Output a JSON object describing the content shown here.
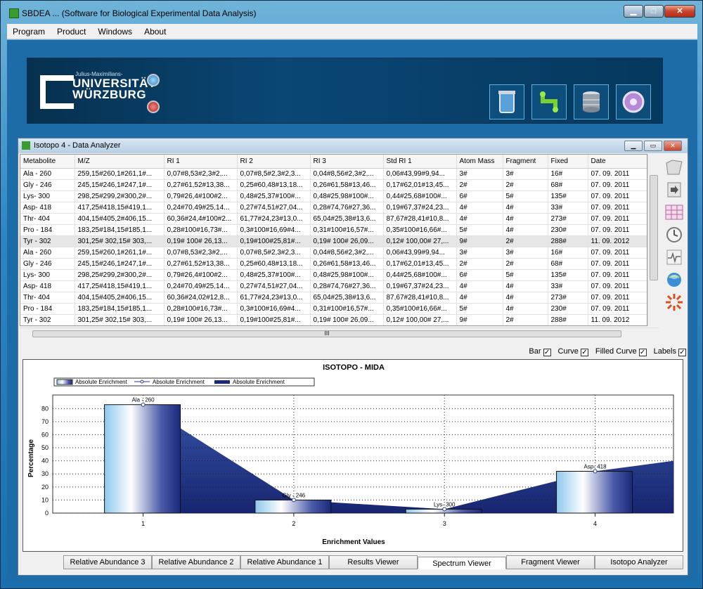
{
  "window": {
    "title": "SBDEA ... (Software for Biological Experimental Data Analysis)"
  },
  "menu": [
    "Program",
    "Product",
    "Windows",
    "About"
  ],
  "banner": {
    "logo_small": "Julius-Maximilians-",
    "logo_line1": "UNIVERSITÄT",
    "logo_line2": "WÜRZBURG"
  },
  "dialog": {
    "title": "Isotopo 4 - Data Analyzer"
  },
  "grid": {
    "columns": [
      "Metabolite",
      "M/Z",
      "RI 1",
      "RI 2",
      "RI 3",
      "Std RI 1",
      "Atom Mass",
      "Fragment",
      "Fixed",
      "Date"
    ],
    "rows": [
      [
        "Ala - 260",
        "259,15#260,1#261,1#...",
        "0,07#8,53#2,3#2,...",
        "0,07#8,5#2,3#2,3...",
        "0,04#8,56#2,3#2,...",
        "0,06#43,99#9,94...",
        "3#",
        "3#",
        "16#",
        "07. 09. 2011"
      ],
      [
        "Gly - 246",
        "245,15#246,1#247,1#...",
        "0,27#61,52#13,38...",
        "0,25#60,48#13,18...",
        "0,26#61,58#13,46...",
        "0,17#62,01#13,45...",
        "2#",
        "2#",
        "68#",
        "07. 09. 2011"
      ],
      [
        "Lys- 300",
        "298,25#299,2#300,2#...",
        "0,79#26,4#100#2...",
        "0,48#25,37#100#...",
        "0,48#25,98#100#...",
        "0,44#25,68#100#...",
        "6#",
        "5#",
        "135#",
        "07. 09. 2011"
      ],
      [
        "Asp- 418",
        "417,25#418,15#419,1...",
        "0,24#70,49#25,14...",
        "0,27#74,51#27,04...",
        "0,28#74,76#27,36...",
        "0,19#67,37#24,23...",
        "4#",
        "4#",
        "33#",
        "07. 09. 2011"
      ],
      [
        "Thr- 404",
        "404,15#405,2#406,15...",
        "60,36#24,4#100#2...",
        "61,77#24,23#13,0...",
        "65,04#25,38#13,6...",
        "87,67#28,41#10,8...",
        "4#",
        "4#",
        "273#",
        "07. 09. 2011"
      ],
      [
        "Pro - 184",
        "183,25#184,15#185,1...",
        "0,28#100#16,73#...",
        "0,3#100#16,69#4...",
        "0,31#100#16,57#...",
        "0,35#100#16,66#...",
        "5#",
        "4#",
        "230#",
        "07. 09. 2011"
      ],
      [
        "Tyr - 302",
        "301,25# 302,15# 303,...",
        "0,19# 100# 26,13...",
        "0,19#100#25,81#...",
        "0,19# 100# 26,09...",
        "0,12# 100,00# 27,...",
        "9#",
        "2#",
        "288#",
        "11. 09. 2012"
      ],
      [
        "Ala - 260",
        "259,15#260,1#261,1#...",
        "0,07#8,53#2,3#2,...",
        "0,07#8,5#2,3#2,3...",
        "0,04#8,56#2,3#2,...",
        "0,06#43,99#9,94...",
        "3#",
        "3#",
        "16#",
        "07. 09. 2011"
      ],
      [
        "Gly - 246",
        "245,15#246,1#247,1#...",
        "0,27#61,52#13,38...",
        "0,25#60,48#13,18...",
        "0,26#61,58#13,46...",
        "0,17#62,01#13,45...",
        "2#",
        "2#",
        "68#",
        "07. 09. 2011"
      ],
      [
        "Lys- 300",
        "298,25#299,2#300,2#...",
        "0,79#26,4#100#2...",
        "0,48#25,37#100#...",
        "0,48#25,98#100#...",
        "0,44#25,68#100#...",
        "6#",
        "5#",
        "135#",
        "07. 09. 2011"
      ],
      [
        "Asp- 418",
        "417,25#418,15#419,1...",
        "0,24#70,49#25,14...",
        "0,27#74,51#27,04...",
        "0,28#74,76#27,36...",
        "0,19#67,37#24,23...",
        "4#",
        "4#",
        "33#",
        "07. 09. 2011"
      ],
      [
        "Thr- 404",
        "404,15#405,2#406,15...",
        "60,36#24,02#12,8...",
        "61,77#24,23#13,0...",
        "65,04#25,38#13,6...",
        "87,67#28,41#10,8...",
        "4#",
        "4#",
        "273#",
        "07. 09. 2011"
      ],
      [
        "Pro - 184",
        "183,25#184,15#185,1...",
        "0,28#100#16,73#...",
        "0,3#100#16,69#4...",
        "0,31#100#16,57#...",
        "0,35#100#16,66#...",
        "5#",
        "4#",
        "230#",
        "07. 09. 2011"
      ],
      [
        "Tyr - 302",
        "301,25# 302,15# 303,...",
        "0,19# 100# 26,13...",
        "0,19#100#25,81#...",
        "0,19# 100# 26,09...",
        "0,12# 100,00# 27,...",
        "9#",
        "2#",
        "288#",
        "11. 09. 2012"
      ]
    ],
    "selected_row": 6
  },
  "options": {
    "bar": "Bar",
    "curve": "Curve",
    "filled_curve": "Filled Curve",
    "labels": "Labels"
  },
  "chart_data": {
    "type": "bar",
    "title": "ISOTOPO - MIDA",
    "xlabel": "Enrichment Values",
    "ylabel": "Percentage",
    "x": [
      1,
      2,
      3,
      4
    ],
    "categories": [
      "Ala - 260",
      "Gly - 246",
      "Lys- 300",
      "Asp- 418"
    ],
    "values": [
      83,
      10,
      3,
      32
    ],
    "curve_end_value": 40,
    "ylim": [
      0,
      85
    ],
    "yticks": [
      0,
      10,
      20,
      30,
      40,
      50,
      60,
      70,
      80
    ],
    "xticks": [
      "1",
      "2",
      "3",
      "4"
    ],
    "legend": [
      "Absolute Enrichment",
      "Absolute Enrichment",
      "Absolute Enrichment"
    ],
    "legend_position": "top-left",
    "grid": true
  },
  "tabs": [
    "Relative Abundance 3",
    "Relative Abundance 2",
    "Relative Abundance 1",
    "Results Viewer",
    "Spectrum Viewer",
    "Fragment Viewer",
    "Isotopo Analyzer"
  ],
  "active_tab": 4
}
